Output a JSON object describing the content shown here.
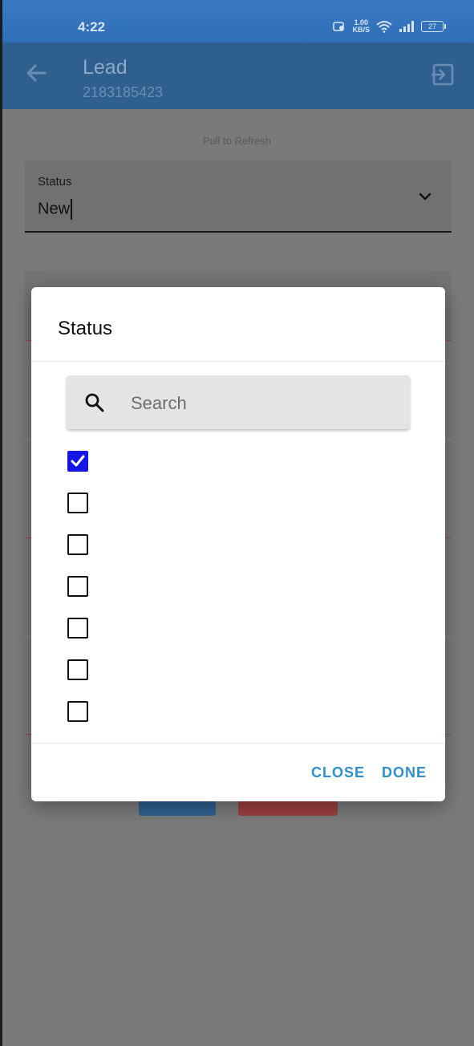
{
  "status_bar": {
    "time": "4:22",
    "speed_value": "1.00",
    "speed_unit": "KB/S",
    "battery": "27"
  },
  "app_bar": {
    "title": "Lead",
    "subtitle": "2183185423"
  },
  "form": {
    "pull_to_refresh": "Pull to Refresh",
    "status_label": "Status",
    "status_value": "New"
  },
  "dialog": {
    "title": "Status",
    "search_placeholder": "Search",
    "options_checked": [
      true,
      false,
      false,
      false,
      false,
      false,
      false
    ],
    "close_label": "CLOSE",
    "done_label": "DONE"
  },
  "colors": {
    "accent": "#2f8fc9",
    "checkbox_checked": "#1515e6",
    "app_bar": "#2e5f8f"
  }
}
